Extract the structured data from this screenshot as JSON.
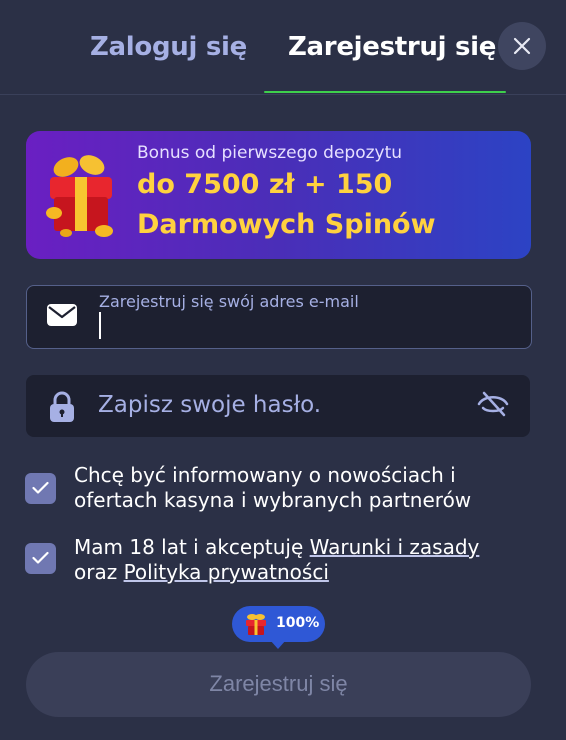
{
  "tabs": {
    "login": "Zaloguj się",
    "register": "Zarejestruj się",
    "active": "register"
  },
  "close_icon": "close-icon",
  "bonus": {
    "subtitle": "Bonus od pierwszego depozytu",
    "line1": "do 7500 zł + 150",
    "line2": "Darmowych Spinów",
    "icon": "gift-icon"
  },
  "email": {
    "label": "Zarejestruj się swój adres e-mail",
    "value": "",
    "icon": "envelope-icon"
  },
  "password": {
    "placeholder": "Zapisz swoje hasło.",
    "value": "",
    "icon": "lock-icon",
    "toggle_icon": "eye-off-icon"
  },
  "checkboxes": [
    {
      "checked": true,
      "line1": "Chcę być informowany o nowościach i",
      "line2": "ofertach kasyna i wybranych partnerów"
    },
    {
      "checked": true,
      "prefix": "Mam 18 lat i akceptuję ",
      "link1": "Warunki i zasady",
      "middle": "oraz ",
      "link2": "Polityka prywatności"
    }
  ],
  "bonus_badge": {
    "text": "100%",
    "icon": "gift-icon"
  },
  "submit": {
    "label": "Zarejestruj się",
    "enabled": false
  },
  "colors": {
    "background": "#2b3046",
    "accent_underline": "#3ecf4c",
    "bonus_text": "#ffd23f",
    "badge": "#2f58d6"
  }
}
